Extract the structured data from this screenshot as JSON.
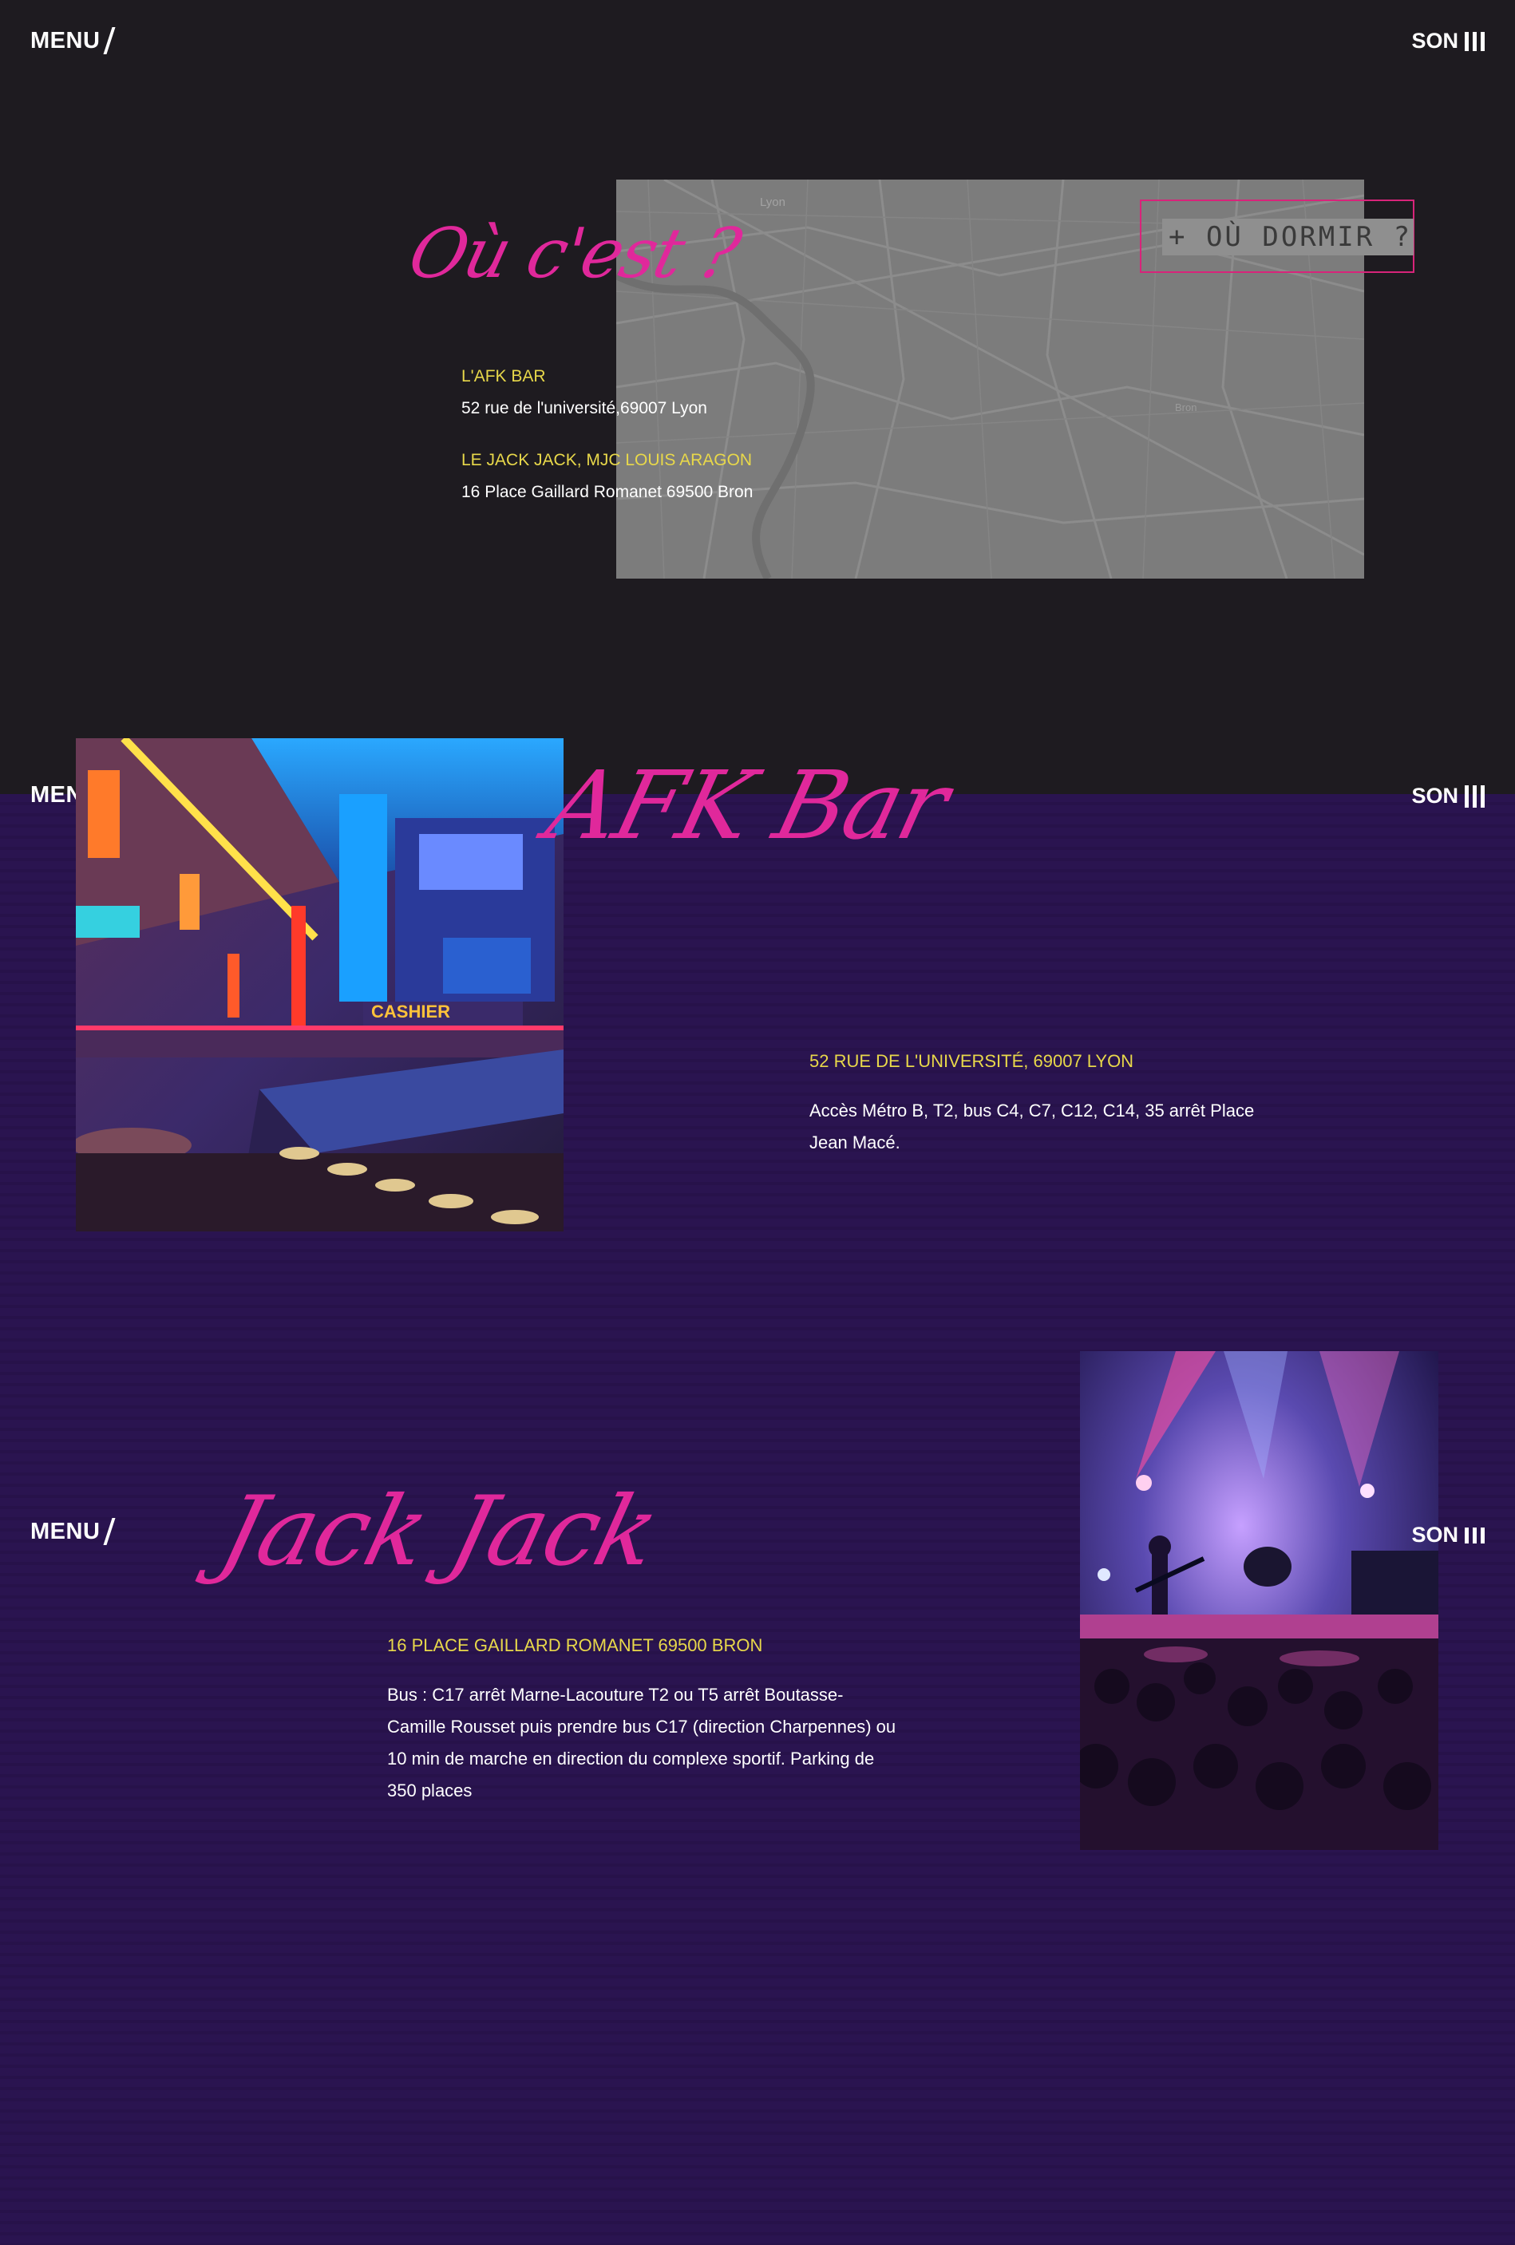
{
  "header": {
    "menu_label": "MENU",
    "son_label": "SON"
  },
  "where": {
    "title": "Où c'est ?",
    "venues": [
      {
        "name": "L'AFK BAR",
        "address": "52 rue de l'université,69007 Lyon"
      },
      {
        "name": "LE JACK JACK, MJC LOUIS ARAGON",
        "address": "16 Place Gaillard Romanet 69500 Bron"
      }
    ],
    "sleep_button": "+ OÙ DORMIR ?",
    "map_labels": [
      "Lyon",
      "Bron"
    ]
  },
  "afk": {
    "title": "AFK Bar",
    "address": "52 RUE DE L'UNIVERSITÉ, 69007 LYON",
    "access": "Accès Métro B, T2, bus C4, C7, C12, C14, 35 arrêt Place Jean Macé.",
    "photo_sign": "CASHIER"
  },
  "jack": {
    "title": "Jack Jack",
    "address": "16 PLACE GAILLARD ROMANET 69500 BRON",
    "access": "Bus : C17 arrêt Marne-Lacouture T2 ou T5 arrêt Boutasse-Camille Rousset puis prendre bus C17 (direction Charpennes) ou 10 min de marche en direction du complexe sportif. Parking de 350 places"
  },
  "colors": {
    "accent_pink": "#e0289b",
    "accent_yellow": "#e8d84a",
    "dark_bg": "#1e1b20",
    "purple_bg": "#2a1450"
  }
}
